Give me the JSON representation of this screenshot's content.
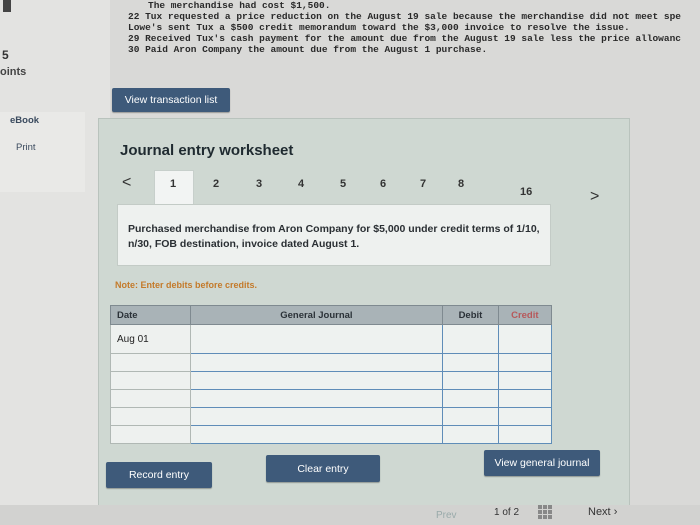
{
  "problem_lines": [
    "The merchandise had cost $1,500.",
    "22 Tux requested a price reduction on the August 19 sale because the merchandise did not meet spe",
    "   Lowe's sent Tux a $500 credit memorandum toward the $3,000 invoice to resolve the issue.",
    "29 Received Tux's cash payment for the amount due from the August 19 sale less the price allowanc",
    "30 Paid Aron Company the amount due from the August 1 purchase."
  ],
  "sidebar": {
    "points_value": "5",
    "points_label": "oints",
    "ebook": "eBook",
    "print": "Print"
  },
  "view_transaction_list": "View transaction list",
  "worksheet": {
    "title": "Journal entry worksheet",
    "prev_arrow": "<",
    "next_arrow": ">",
    "pages": [
      "1",
      "2",
      "3",
      "4",
      "5",
      "6",
      "7",
      "8",
      "16"
    ],
    "active_page": "1",
    "description": "Purchased merchandise from Aron Company for $5,000 under credit terms of 1/10, n/30, FOB destination, invoice dated August 1.",
    "note": "Note: Enter debits before credits.",
    "columns": {
      "date": "Date",
      "general_journal": "General Journal",
      "debit": "Debit",
      "credit": "Credit"
    },
    "rows": [
      {
        "date": "Aug 01",
        "account": "",
        "debit": "",
        "credit": ""
      },
      {
        "date": "",
        "account": "",
        "debit": "",
        "credit": ""
      },
      {
        "date": "",
        "account": "",
        "debit": "",
        "credit": ""
      },
      {
        "date": "",
        "account": "",
        "debit": "",
        "credit": ""
      },
      {
        "date": "",
        "account": "",
        "debit": "",
        "credit": ""
      },
      {
        "date": "",
        "account": "",
        "debit": "",
        "credit": ""
      }
    ],
    "record_entry": "Record entry",
    "clear_entry": "Clear entry",
    "view_general_journal": "View general journal"
  },
  "footer": {
    "prev": "Prev",
    "page_current": "1",
    "page_of": "of 2",
    "next": "Next"
  },
  "colors": {
    "button": "#3e5a7a",
    "note": "#c47a2a",
    "input_border": "#5f8db8"
  }
}
